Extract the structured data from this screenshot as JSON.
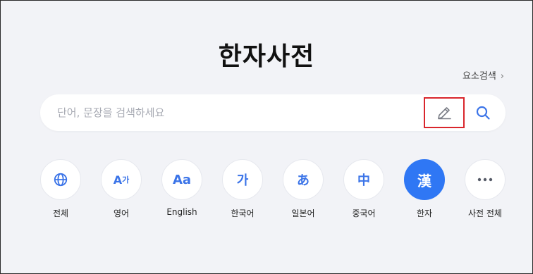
{
  "header": {
    "title": "한자사전",
    "element_search_label": "요소검색",
    "element_search_chevron": "›"
  },
  "search": {
    "placeholder": "단어, 문장을 검색하세요",
    "value": "",
    "handwrite_icon": "pencil-icon",
    "search_icon": "magnifier-icon"
  },
  "categories": [
    {
      "id": "all",
      "label": "전체",
      "icon": "globe-icon"
    },
    {
      "id": "english-dict",
      "label": "영어",
      "icon_text": "A",
      "icon_text2": "가"
    },
    {
      "id": "english",
      "label": "English",
      "icon_text": "Aa"
    },
    {
      "id": "korean",
      "label": "한국어",
      "icon_text": "가"
    },
    {
      "id": "japanese",
      "label": "일본어",
      "icon_text": "あ"
    },
    {
      "id": "chinese",
      "label": "중국어",
      "icon_text": "中"
    },
    {
      "id": "hanja",
      "label": "한자",
      "icon_text": "漢",
      "active": true
    },
    {
      "id": "all-dicts",
      "label": "사전 전체",
      "icon": "more-dots-icon"
    }
  ],
  "colors": {
    "background": "#f2f3f7",
    "accent": "#2f77f4",
    "icon_blue": "#3b74e8",
    "highlight_red": "#d9262c"
  }
}
